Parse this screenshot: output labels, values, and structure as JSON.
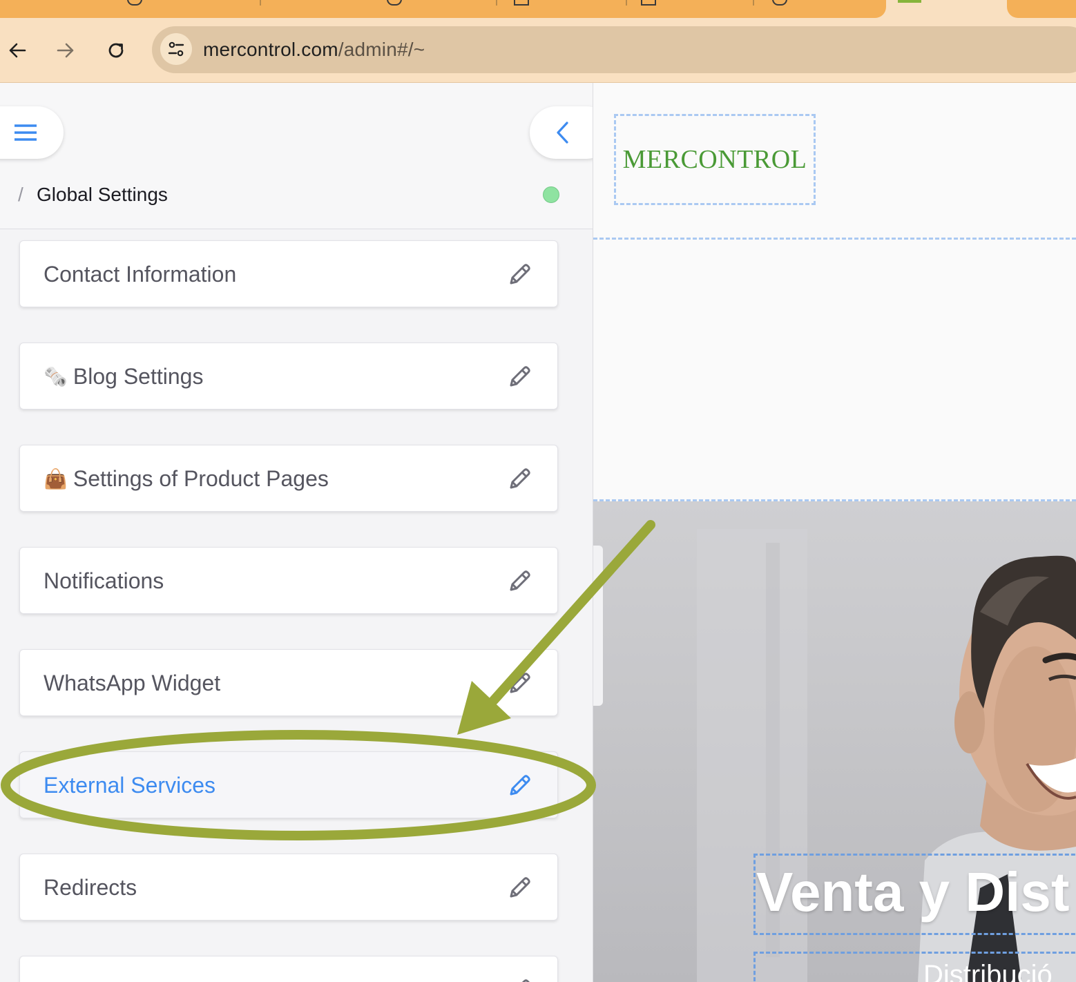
{
  "browser": {
    "url_host": "mercontrol.com",
    "url_path": "/admin#/~",
    "icons": [
      "back-icon",
      "forward-icon",
      "reload-icon",
      "site-settings-icon"
    ]
  },
  "sidebar": {
    "breadcrumb_separator": "/",
    "title": "Global Settings",
    "status_color": "#8fe3a1",
    "items": [
      {
        "label": "Contact Information",
        "emoji": "",
        "active": false
      },
      {
        "label": "Blog Settings",
        "emoji": "🗞️",
        "active": false
      },
      {
        "label": "Settings of Product Pages",
        "emoji": "👜",
        "active": false
      },
      {
        "label": "Notifications",
        "emoji": "",
        "active": false
      },
      {
        "label": "WhatsApp Widget",
        "emoji": "",
        "active": false
      },
      {
        "label": "External Services",
        "emoji": "",
        "active": true
      },
      {
        "label": "Redirects",
        "emoji": "",
        "active": false
      },
      {
        "label": "",
        "emoji": "",
        "active": false
      }
    ]
  },
  "preview": {
    "logo_text": "MERCONTROL",
    "hero_title": "Venta y Dist",
    "hero_subtitle": "Distribució"
  },
  "colors": {
    "accent_blue": "#3d8bf0",
    "annotation_olive": "#9aa83a",
    "logo_green": "#4a9a36"
  }
}
